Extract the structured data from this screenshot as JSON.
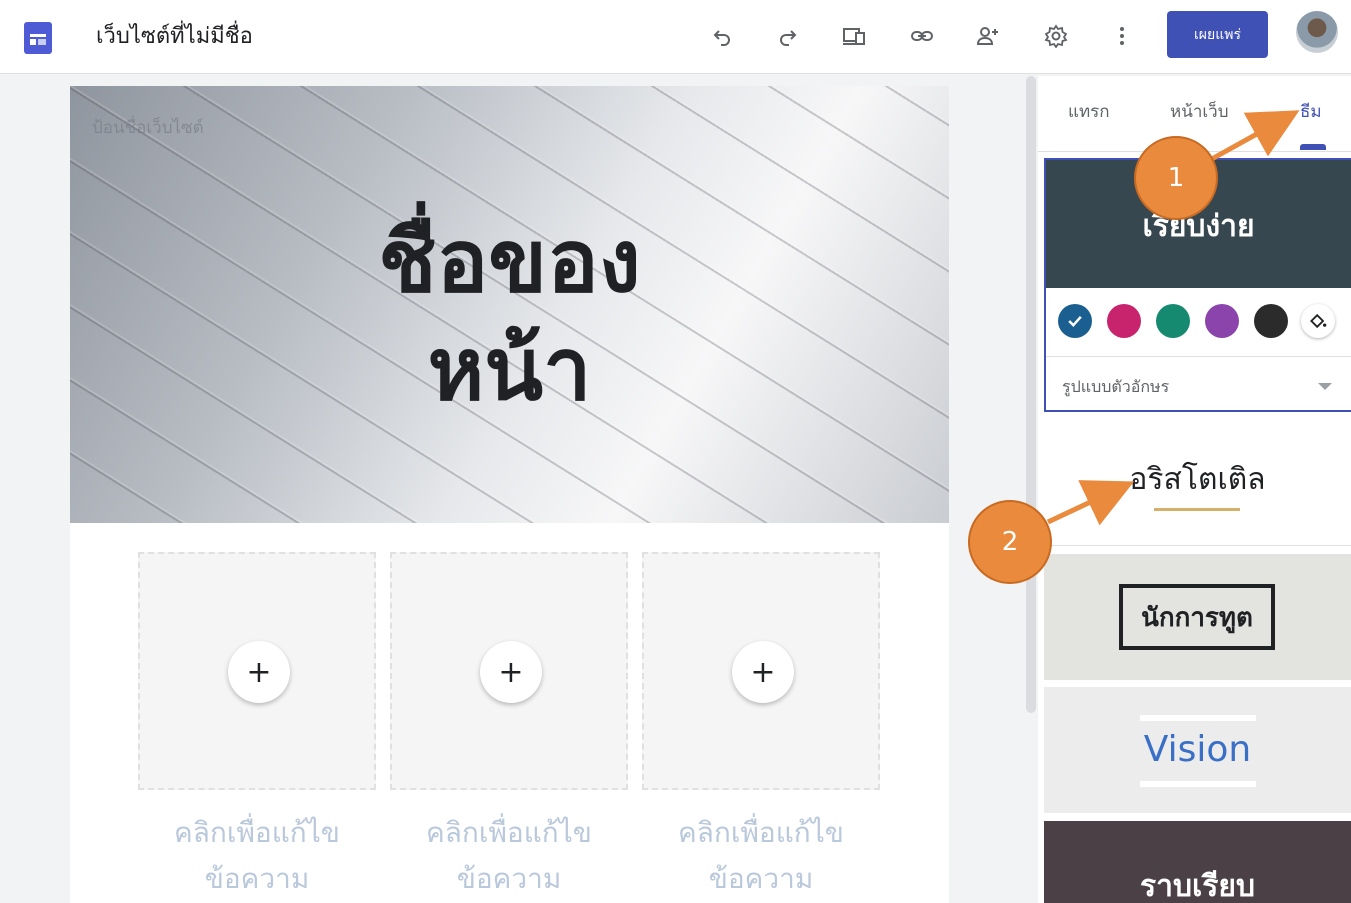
{
  "header": {
    "title": "เว็บไซต์ที่ไม่มีชื่อ",
    "publish_label": "เผยแพร่",
    "icons": [
      "undo-icon",
      "redo-icon",
      "preview-device-icon",
      "link-icon",
      "add-person-icon",
      "settings-gear-icon",
      "more-vert-icon"
    ]
  },
  "canvas": {
    "site_name_placeholder": "ป้อนชื่อเว็บไซต์",
    "page_title_line1": "ชื่อของ",
    "page_title_line2": "หน้า",
    "placeholders": [
      {
        "line1": "คลิกเพื่อแก้ไข",
        "line2": "ข้อความ"
      },
      {
        "line1": "คลิกเพื่อแก้ไข",
        "line2": "ข้อความ"
      },
      {
        "line1": "คลิกเพื่อแก้ไข",
        "line2": "ข้อความ"
      }
    ],
    "plus_symbol": "+"
  },
  "panel": {
    "tabs": [
      {
        "label": "แทรก",
        "active": false
      },
      {
        "label": "หน้าเว็บ",
        "active": false
      },
      {
        "label": "ธีม",
        "active": true
      }
    ],
    "themes": {
      "simple": "เรียบง่าย",
      "aristotle": "อริสโตเติล",
      "diplomat": "นักการทูต",
      "vision": "Vision",
      "level": "ราบเรียบ"
    },
    "font_style_label": "รูปแบบตัวอักษร",
    "colors": [
      "#1a5f8f",
      "#c8246e",
      "#168a70",
      "#8a44ab",
      "#2b2b2b"
    ],
    "selected_color_index": 0
  },
  "annotations": [
    {
      "number": "1"
    },
    {
      "number": "2"
    }
  ],
  "accent_color": "#3f51b5",
  "annotation_color": "#e98a3c"
}
